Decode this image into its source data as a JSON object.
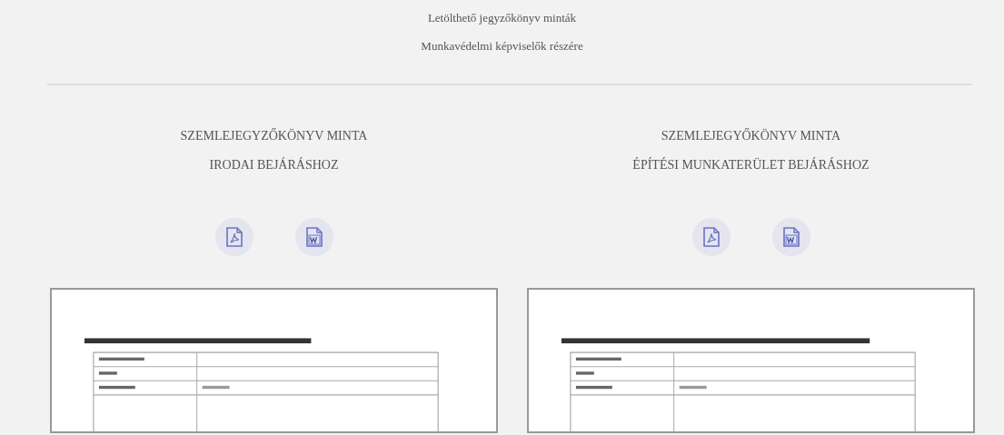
{
  "header": {
    "title": "Letölthető jegyzőkönyv minták",
    "subtitle": "Munkavédelmi képviselők részére"
  },
  "documents": [
    {
      "title_lines": [
        "SZEMLEJEGYZŐKÖNYV MINTA",
        "IRODAI BEJÁRÁSHOZ"
      ],
      "downloads": [
        {
          "kind": "pdf"
        },
        {
          "kind": "word"
        }
      ]
    },
    {
      "title_lines": [
        "SZEMLEJEGYŐKÖNYV MINTA",
        "ÉPÍTÉSI MUNKATERÜLET BEJÁRÁSHOZ"
      ],
      "downloads": [
        {
          "kind": "pdf"
        },
        {
          "kind": "word"
        }
      ]
    }
  ]
}
